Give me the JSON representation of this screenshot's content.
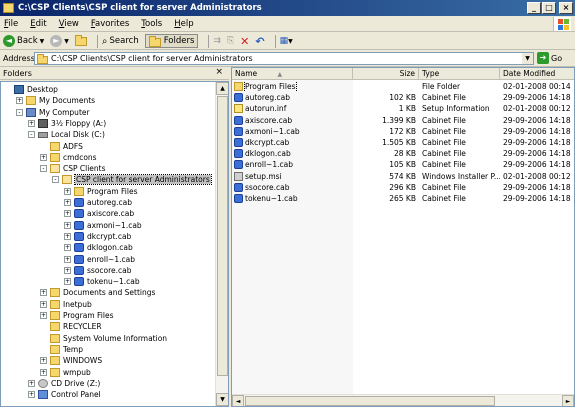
{
  "window": {
    "title": "C:\\CSP Clients\\CSP client for server Administrators"
  },
  "menu": [
    "File",
    "Edit",
    "View",
    "Favorites",
    "Tools",
    "Help"
  ],
  "toolbar": {
    "back": "Back",
    "search": "Search",
    "folders": "Folders"
  },
  "address": {
    "label": "Address",
    "value": "C:\\CSP Clients\\CSP client for server Administrators",
    "go": "Go"
  },
  "folders_pane": {
    "title": "Folders",
    "close": "×",
    "tree": [
      {
        "label": "Desktop",
        "icon": "desktop",
        "level": 0,
        "exp": ""
      },
      {
        "label": "My Documents",
        "icon": "docs",
        "level": 1,
        "exp": "+"
      },
      {
        "label": "My Computer",
        "icon": "mycomp",
        "level": 1,
        "exp": "-"
      },
      {
        "label": "3½ Floppy (A:)",
        "icon": "floppy",
        "level": 2,
        "exp": "+"
      },
      {
        "label": "Local Disk (C:)",
        "icon": "drive",
        "level": 2,
        "exp": "-"
      },
      {
        "label": "ADFS",
        "icon": "folder",
        "level": 3,
        "exp": ""
      },
      {
        "label": "cmdcons",
        "icon": "folder",
        "level": 3,
        "exp": "+"
      },
      {
        "label": "CSP Clients",
        "icon": "openfolder",
        "level": 3,
        "exp": "-"
      },
      {
        "label": "CSP client for server Administrators",
        "icon": "openfolder",
        "level": 4,
        "exp": "-",
        "selected": true
      },
      {
        "label": "Program Files",
        "icon": "folder",
        "level": 5,
        "exp": "+"
      },
      {
        "label": "autoreg.cab",
        "icon": "cab",
        "level": 5,
        "exp": "+"
      },
      {
        "label": "axiscore.cab",
        "icon": "cab",
        "level": 5,
        "exp": "+"
      },
      {
        "label": "axmoni~1.cab",
        "icon": "cab",
        "level": 5,
        "exp": "+"
      },
      {
        "label": "dkcrypt.cab",
        "icon": "cab",
        "level": 5,
        "exp": "+"
      },
      {
        "label": "dklogon.cab",
        "icon": "cab",
        "level": 5,
        "exp": "+"
      },
      {
        "label": "enroll~1.cab",
        "icon": "cab",
        "level": 5,
        "exp": "+"
      },
      {
        "label": "ssocore.cab",
        "icon": "cab",
        "level": 5,
        "exp": "+"
      },
      {
        "label": "tokenu~1.cab",
        "icon": "cab",
        "level": 5,
        "exp": "+"
      },
      {
        "label": "Documents and Settings",
        "icon": "folder",
        "level": 3,
        "exp": "+"
      },
      {
        "label": "Inetpub",
        "icon": "folder",
        "level": 3,
        "exp": "+"
      },
      {
        "label": "Program Files",
        "icon": "folder",
        "level": 3,
        "exp": "+"
      },
      {
        "label": "RECYCLER",
        "icon": "folder",
        "level": 3,
        "exp": ""
      },
      {
        "label": "System Volume Information",
        "icon": "folder",
        "level": 3,
        "exp": ""
      },
      {
        "label": "Temp",
        "icon": "folder",
        "level": 3,
        "exp": ""
      },
      {
        "label": "WINDOWS",
        "icon": "folder",
        "level": 3,
        "exp": "+"
      },
      {
        "label": "wmpub",
        "icon": "folder",
        "level": 3,
        "exp": "+"
      },
      {
        "label": "CD Drive (Z:)",
        "icon": "cd",
        "level": 2,
        "exp": "+"
      },
      {
        "label": "Control Panel",
        "icon": "cpanel",
        "level": 2,
        "exp": "+"
      }
    ]
  },
  "file_list": {
    "columns": {
      "name": "Name",
      "size": "Size",
      "type": "Type",
      "modified": "Date Modified"
    },
    "sort_indicator": "▲",
    "rows": [
      {
        "name": "Program Files",
        "icon": "folder",
        "size": "",
        "type": "File Folder",
        "modified": "02-01-2008 00:14",
        "selected": true
      },
      {
        "name": "autoreg.cab",
        "icon": "cab",
        "size": "102 KB",
        "type": "Cabinet File",
        "modified": "29-09-2006 14:18"
      },
      {
        "name": "autorun.inf",
        "icon": "inf",
        "size": "1 KB",
        "type": "Setup Information",
        "modified": "02-01-2008 00:12"
      },
      {
        "name": "axiscore.cab",
        "icon": "cab",
        "size": "1.399 KB",
        "type": "Cabinet File",
        "modified": "29-09-2006 14:18"
      },
      {
        "name": "axmoni~1.cab",
        "icon": "cab",
        "size": "172 KB",
        "type": "Cabinet File",
        "modified": "29-09-2006 14:18"
      },
      {
        "name": "dkcrypt.cab",
        "icon": "cab",
        "size": "1.505 KB",
        "type": "Cabinet File",
        "modified": "29-09-2006 14:18"
      },
      {
        "name": "dklogon.cab",
        "icon": "cab",
        "size": "28 KB",
        "type": "Cabinet File",
        "modified": "29-09-2006 14:18"
      },
      {
        "name": "enroll~1.cab",
        "icon": "cab",
        "size": "105 KB",
        "type": "Cabinet File",
        "modified": "29-09-2006 14:18"
      },
      {
        "name": "setup.msi",
        "icon": "msi",
        "size": "574 KB",
        "type": "Windows Installer P...",
        "modified": "02-01-2008 00:12"
      },
      {
        "name": "ssocore.cab",
        "icon": "cab",
        "size": "296 KB",
        "type": "Cabinet File",
        "modified": "29-09-2006 14:18"
      },
      {
        "name": "tokenu~1.cab",
        "icon": "cab",
        "size": "265 KB",
        "type": "Cabinet File",
        "modified": "29-09-2006 14:18"
      }
    ]
  }
}
